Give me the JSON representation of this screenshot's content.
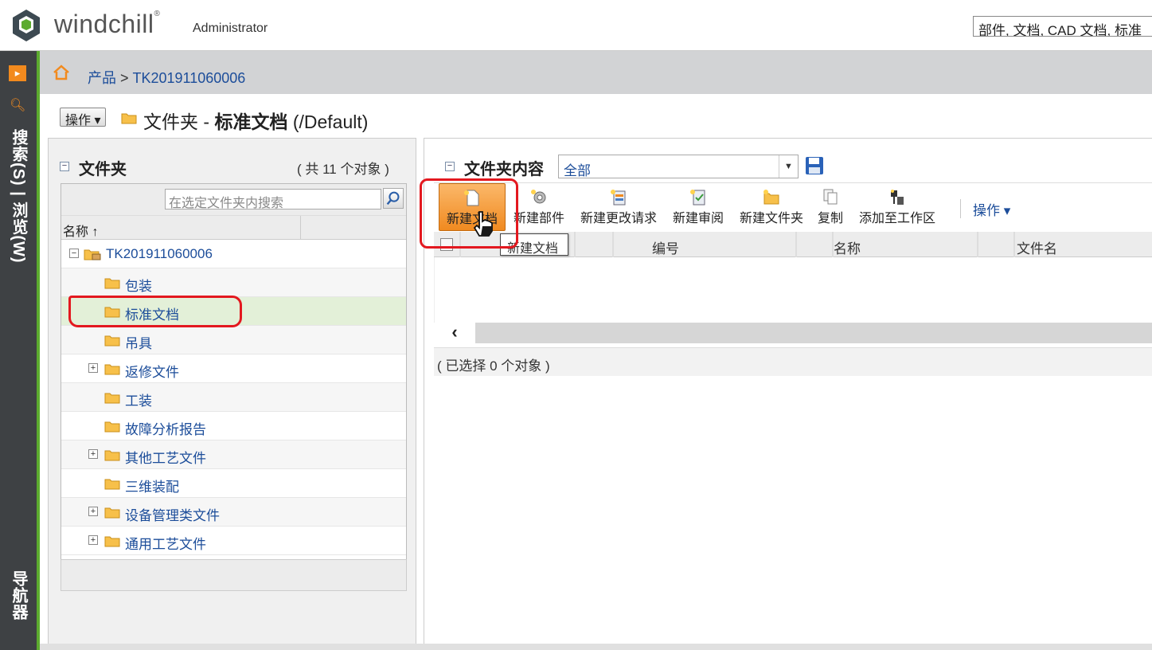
{
  "header": {
    "brand": "windchill",
    "user": "Administrator",
    "global_search_value": "部件, 文档, CAD 文档, 标准"
  },
  "leftnav": {
    "search_browse_label": "搜索(S) | 浏览(W)",
    "navigator_label": "导航器",
    "accent_color": "#f28a1e",
    "border_color": "#5cab2f"
  },
  "breadcrumb": {
    "root": "产品",
    "separator": " > ",
    "current": "TK201911060006"
  },
  "page": {
    "actions_label": "操作 ▾",
    "title_prefix": "文件夹 - ",
    "title_bold": "标准文档",
    "title_suffix": " (/Default)"
  },
  "folder_panel": {
    "title": "文件夹",
    "count": "( 共 11 个对象 )",
    "search_placeholder": "在选定文件夹内搜索",
    "column_name": "名称 ↑",
    "root": "TK201911060006",
    "items": [
      {
        "label": "包装",
        "expandable": false
      },
      {
        "label": "标准文档",
        "expandable": false,
        "selected": true
      },
      {
        "label": "吊具",
        "expandable": false
      },
      {
        "label": "返修文件",
        "expandable": true
      },
      {
        "label": "工装",
        "expandable": false
      },
      {
        "label": "故障分析报告",
        "expandable": false
      },
      {
        "label": "其他工艺文件",
        "expandable": true
      },
      {
        "label": "三维装配",
        "expandable": false
      },
      {
        "label": "设备管理类文件",
        "expandable": true
      },
      {
        "label": "通用工艺文件",
        "expandable": true
      }
    ]
  },
  "content_panel": {
    "title": "文件夹内容",
    "view_value": "全部",
    "toolbar": [
      {
        "label": "新建文档",
        "icon": "new-document-icon",
        "active": true
      },
      {
        "label": "新建部件",
        "icon": "new-part-icon"
      },
      {
        "label": "新建更改请求",
        "icon": "new-change-request-icon"
      },
      {
        "label": "新建审阅",
        "icon": "new-review-icon"
      },
      {
        "label": "新建文件夹",
        "icon": "new-folder-icon"
      },
      {
        "label": "复制",
        "icon": "copy-icon"
      },
      {
        "label": "添加至工作区",
        "icon": "add-to-workspace-icon"
      }
    ],
    "actions_label": "操作 ▾",
    "tooltip": "新建文档",
    "columns": [
      "编号",
      "名称",
      "文件名"
    ],
    "selection_status": "( 已选择 0 个对象 )"
  }
}
